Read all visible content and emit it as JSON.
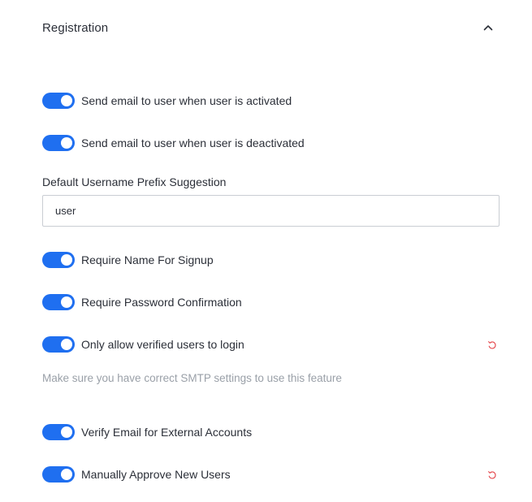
{
  "section": {
    "title": "Registration",
    "collapse_icon": "chevron-up-icon"
  },
  "toggles": [
    {
      "label": "Send email to user when user is activated",
      "enabled": true,
      "has_reset": false
    },
    {
      "label": "Send email to user when user is deactivated",
      "enabled": true,
      "has_reset": false
    },
    {
      "label": "Require Name For Signup",
      "enabled": true,
      "has_reset": false
    },
    {
      "label": "Require Password Confirmation",
      "enabled": true,
      "has_reset": false
    },
    {
      "label": "Only allow verified users to login",
      "enabled": true,
      "has_reset": true
    },
    {
      "label": "Verify Email for External Accounts",
      "enabled": true,
      "has_reset": false
    },
    {
      "label": "Manually Approve New Users",
      "enabled": true,
      "has_reset": true
    }
  ],
  "username_prefix": {
    "label": "Default Username Prefix Suggestion",
    "value": "user"
  },
  "smtp_notice": "Make sure you have correct SMTP settings to use this feature",
  "colors": {
    "toggle_on": "#1f6ff0",
    "reset_icon": "#e5484d",
    "help_text": "#9aa0a8"
  }
}
